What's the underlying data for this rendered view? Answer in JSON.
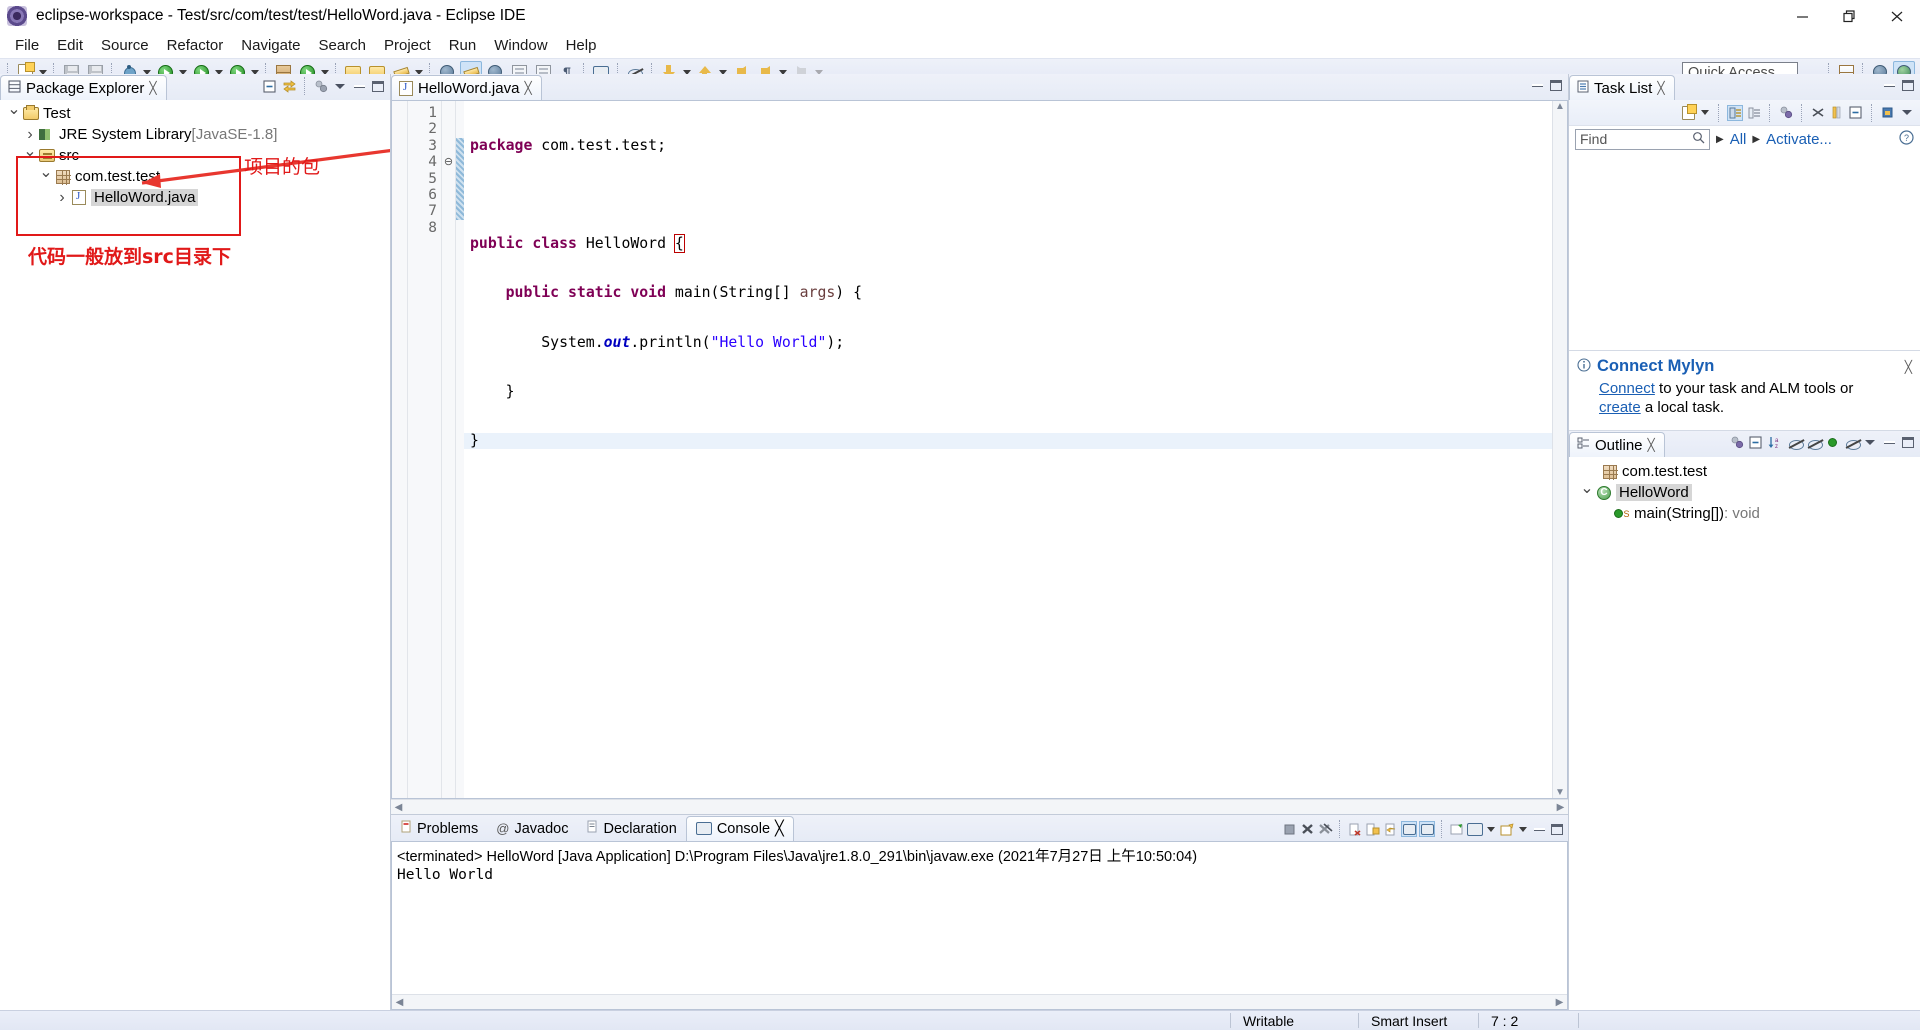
{
  "window": {
    "title": "eclipse-workspace - Test/src/com/test/test/HelloWord.java - Eclipse IDE",
    "app_icon": "eclipse-icon",
    "controls": {
      "minimize": "minimize-icon",
      "restore": "restore-icon",
      "close": "close-icon"
    }
  },
  "menubar": {
    "items": [
      "File",
      "Edit",
      "Source",
      "Refactor",
      "Navigate",
      "Search",
      "Project",
      "Run",
      "Window",
      "Help"
    ]
  },
  "toolbar": {
    "quick_access_placeholder": "Quick Access",
    "icons": [
      "new-wizard-icon",
      "save-icon",
      "save-all-icon",
      "debug-icon",
      "run-icon",
      "run-last-tool-icon",
      "run-external-icon",
      "new-java-package-icon",
      "new-java-class-icon",
      "open-type-icon",
      "open-task-icon",
      "toggle-mark-occurrences-icon",
      "new-annotation-icon",
      "skip-breakpoints-icon",
      "toggle-block-selection-icon",
      "show-whitespace-icon",
      "open-console-icon",
      "hide-nonpublic-icon",
      "next-annotation-icon",
      "previous-annotation-icon",
      "back-icon",
      "forward-icon",
      "open-perspective-icon",
      "java-perspective-icon",
      "debug-perspective-icon"
    ]
  },
  "package_explorer": {
    "tab_label": "Package Explorer",
    "tab_icon": "package-explorer-icon",
    "close_icon": "close-icon",
    "tools": [
      "collapse-all-icon",
      "link-with-editor-icon",
      "focus-on-active-task-icon",
      "view-menu-icon",
      "minimize-icon",
      "maximize-icon"
    ],
    "tree": [
      {
        "label": "Test",
        "icon": "java-project-icon",
        "indent": 0,
        "twisty": "open",
        "selected": false
      },
      {
        "label": "JRE System Library",
        "suffix": " [JavaSE-1.8]",
        "icon": "jre-library-icon",
        "indent": 1,
        "twisty": "closed",
        "selected": false
      },
      {
        "label": "src",
        "icon": "source-folder-icon",
        "indent": 1,
        "twisty": "open",
        "selected": false
      },
      {
        "label": "com.test.test",
        "icon": "package-icon",
        "indent": 2,
        "twisty": "open",
        "selected": false
      },
      {
        "label": "HelloWord.java",
        "icon": "java-file-icon",
        "indent": 3,
        "twisty": "closed",
        "selected": true
      }
    ],
    "annotations": {
      "box_color": "#e11919",
      "arrow_color": "#e11919",
      "label_package": "项目的包",
      "label_src": "代码一般放到src目录下"
    }
  },
  "editor": {
    "tab_label": "HelloWord.java",
    "tab_icon": "java-file-icon",
    "close_icon": "close-icon",
    "tools": [
      "minimize-icon",
      "maximize-icon"
    ],
    "lines": [
      {
        "no": "1",
        "fold": "",
        "current": false,
        "tokens": [
          {
            "t": "package",
            "c": "kw"
          },
          {
            "t": " com.test.test;",
            "c": ""
          }
        ]
      },
      {
        "no": "2",
        "fold": "",
        "current": false,
        "tokens": [
          {
            "t": "",
            "c": ""
          }
        ]
      },
      {
        "no": "3",
        "fold": "",
        "current": false,
        "tokens": [
          {
            "t": "public class",
            "c": "kw"
          },
          {
            "t": " HelloWord ",
            "c": ""
          },
          {
            "t": "{",
            "c": "brkt"
          }
        ]
      },
      {
        "no": "4",
        "fold": "⊖",
        "current": false,
        "tokens": [
          {
            "t": "    ",
            "c": ""
          },
          {
            "t": "public static void",
            "c": "kw"
          },
          {
            "t": " main(String[] ",
            "c": ""
          },
          {
            "t": "args",
            "c": "prm"
          },
          {
            "t": ") {",
            "c": ""
          }
        ]
      },
      {
        "no": "5",
        "fold": "",
        "current": false,
        "tokens": [
          {
            "t": "        System.",
            "c": ""
          },
          {
            "t": "out",
            "c": "fld"
          },
          {
            "t": ".println(",
            "c": ""
          },
          {
            "t": "\"Hello World\"",
            "c": "str"
          },
          {
            "t": ");",
            "c": ""
          }
        ]
      },
      {
        "no": "6",
        "fold": "",
        "current": false,
        "tokens": [
          {
            "t": "    }",
            "c": ""
          }
        ]
      },
      {
        "no": "7",
        "fold": "",
        "current": true,
        "tokens": [
          {
            "t": "}",
            "c": ""
          }
        ]
      },
      {
        "no": "8",
        "fold": "",
        "current": false,
        "tokens": [
          {
            "t": "",
            "c": ""
          }
        ]
      }
    ]
  },
  "console": {
    "tabs": [
      {
        "label": "Problems",
        "icon": "problems-icon",
        "active": false
      },
      {
        "label": "Javadoc",
        "icon": "javadoc-icon",
        "active": false
      },
      {
        "label": "Declaration",
        "icon": "declaration-icon",
        "active": false
      },
      {
        "label": "Console",
        "icon": "console-icon",
        "active": true
      }
    ],
    "close_icon": "close-icon",
    "header": "<terminated> HelloWord [Java Application] D:\\Program Files\\Java\\jre1.8.0_291\\bin\\javaw.exe (2021年7月27日 上午10:50:04)",
    "output": "Hello World",
    "tools": [
      "terminate-icon",
      "remove-launch-icon",
      "remove-all-terminated-icon",
      "clear-console-icon",
      "scroll-lock-icon",
      "word-wrap-icon",
      "show-console-on-output-icon",
      "show-console-on-error-icon",
      "pin-console-icon",
      "display-selected-console-icon",
      "console-menu-arrow-icon",
      "open-console-icon",
      "open-console-arrow-icon",
      "minimize-icon",
      "maximize-icon"
    ]
  },
  "task_list": {
    "tab_label": "Task List",
    "tab_icon": "task-list-icon",
    "close_icon": "close-icon",
    "tools": [
      "new-task-icon",
      "new-task-arrow-icon",
      "categorized-presentation-icon",
      "scheduled-presentation-icon",
      "focus-on-workweek-icon",
      "collapse-all-icon",
      "synchronize-changed-icon",
      "link-with-editor-icon",
      "restore-task-icon",
      "view-menu-icon",
      "minimize-icon",
      "maximize-icon"
    ],
    "find_placeholder": "Find",
    "find_value": "",
    "search_icon": "search-icon",
    "filters": [
      "All",
      "Activate..."
    ],
    "help_icon": "help-icon"
  },
  "mylyn": {
    "info_icon": "info-icon",
    "title": "Connect Mylyn",
    "link1": "Connect",
    "text1": " to your task and ALM tools or",
    "link2": "create",
    "text2": " a local task.",
    "close_icon": "close-icon"
  },
  "outline": {
    "tab_label": "Outline",
    "tab_icon": "outline-icon",
    "close_icon": "close-icon",
    "tools": [
      "focus-on-active-task-icon",
      "collapse-all-icon",
      "sort-icon",
      "hide-fields-icon",
      "hide-static-icon",
      "hide-nonpublic-icon",
      "hide-local-types-icon",
      "view-menu-icon",
      "minimize-icon",
      "maximize-icon"
    ],
    "tree": [
      {
        "label": "com.test.test",
        "icon": "package-icon",
        "indent": 1,
        "twisty": "",
        "selected": false
      },
      {
        "label": "HelloWord",
        "icon": "class-icon",
        "indent": 0,
        "twisty": "open",
        "selected": true
      },
      {
        "label": "main(String[])",
        "suffix": " : void",
        "icon": "method-icon",
        "indent": 2,
        "twisty": "",
        "selected": false
      }
    ]
  },
  "statusbar": {
    "cells": [
      "Writable",
      "Smart Insert",
      "7 : 2"
    ]
  },
  "colors": {
    "accent": "#1a5fb4",
    "annotation": "#e11919",
    "keyword": "#7f0055",
    "string": "#2a00ff",
    "field": "#0000c0",
    "selection": "#d6d6d6"
  }
}
